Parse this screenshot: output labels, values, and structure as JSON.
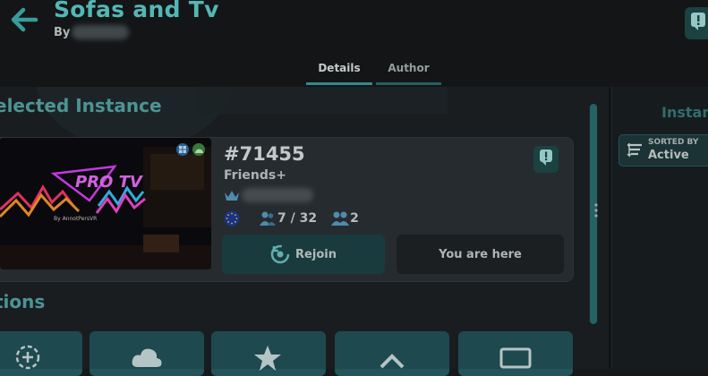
{
  "header": {
    "title": "Sofas and Tv",
    "by_label": "By"
  },
  "tabs": [
    {
      "label": "Details",
      "active": true
    },
    {
      "label": "Author",
      "active": false
    }
  ],
  "sections": {
    "selected_instance": "elected Instance",
    "actions": "tions"
  },
  "instance": {
    "id": "#71455",
    "access": "Friends+",
    "players": "7 / 32",
    "friends": "2",
    "rejoin_label": "Rejoin",
    "here_label": "You are here",
    "thumbnail_text": "By AnnotPersVR",
    "thumbnail_logo": "PRO TV"
  },
  "right_panel": {
    "title": "Instanc",
    "sort_label": "SORTED BY",
    "sort_value": "Active"
  },
  "colors": {
    "accent": "#5fd1cf",
    "button_teal": "#1e4446"
  },
  "icons": [
    "back-arrow-icon",
    "report-icon",
    "windows-icon",
    "android-icon",
    "crown-icon",
    "region-eu-icon",
    "players-icon",
    "friends-icon",
    "rejoin-icon",
    "sort-icon"
  ]
}
